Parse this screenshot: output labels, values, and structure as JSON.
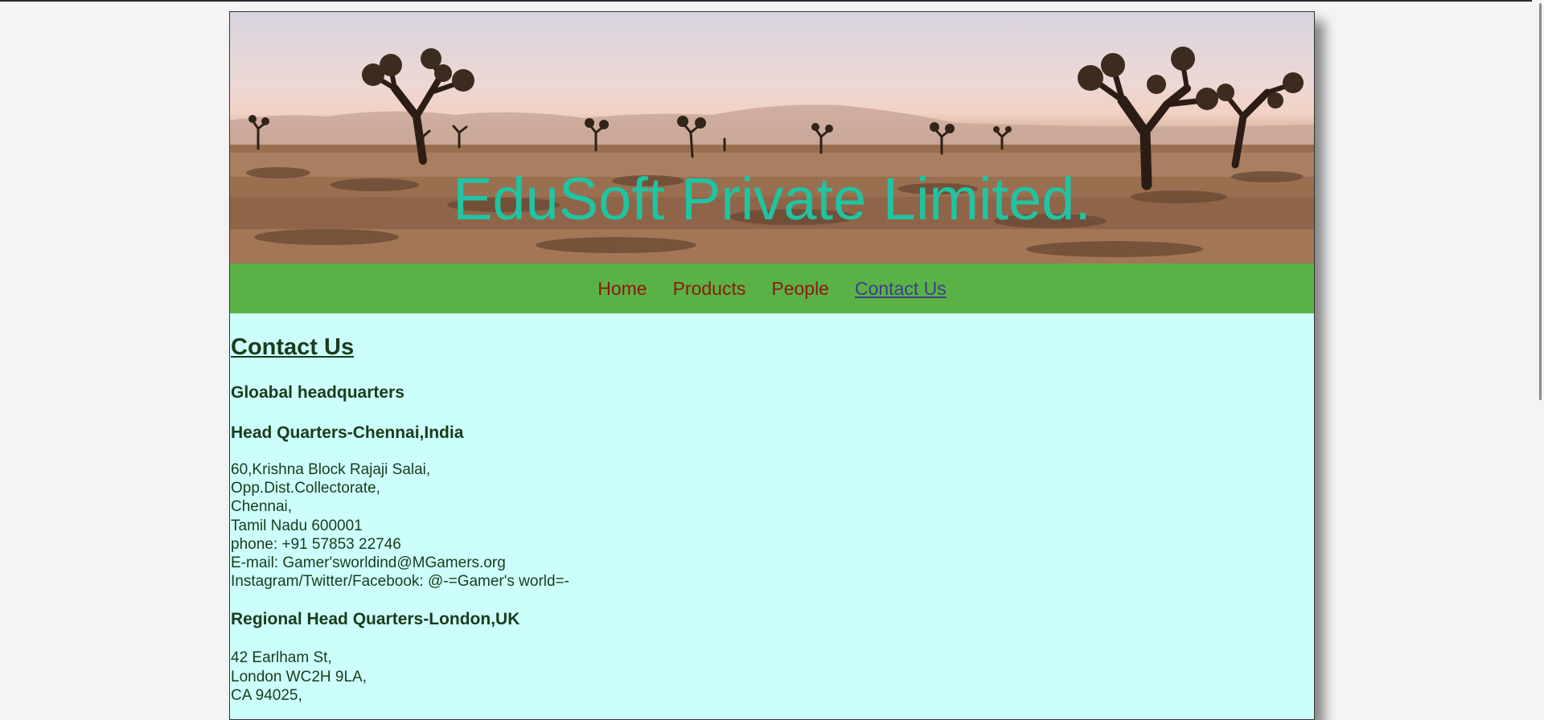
{
  "banner": {
    "title": "EduSoft Private Limited."
  },
  "nav": {
    "items": [
      {
        "label": "Home"
      },
      {
        "label": "Products"
      },
      {
        "label": "People"
      },
      {
        "label": "Contact Us"
      }
    ],
    "active": "Contact Us"
  },
  "content": {
    "page_title": "Contact Us",
    "global_heading": "Gloabal headquarters",
    "chennai": {
      "heading": "Head Quarters-Chennai,India",
      "lines": [
        "60,Krishna Block Rajaji Salai,",
        "Opp.Dist.Collectorate,",
        "Chennai,",
        "Tamil Nadu 600001",
        "phone: +91 57853 22746",
        "E-mail: Gamer'sworldind@MGamers.org",
        "Instagram/Twitter/Facebook: @-=Gamer's world=-"
      ]
    },
    "london": {
      "heading": "Regional Head Quarters-London,UK",
      "lines": [
        "42 Earlham St,",
        "London WC2H 9LA,",
        "CA 94025,"
      ]
    }
  },
  "colors": {
    "nav_bg": "#5ab246",
    "nav_link": "#8b1a10",
    "nav_active": "#3d3f8a",
    "content_bg": "#ccfffc",
    "title_color": "#1fc4a2",
    "text_color": "#1a3b1c"
  }
}
